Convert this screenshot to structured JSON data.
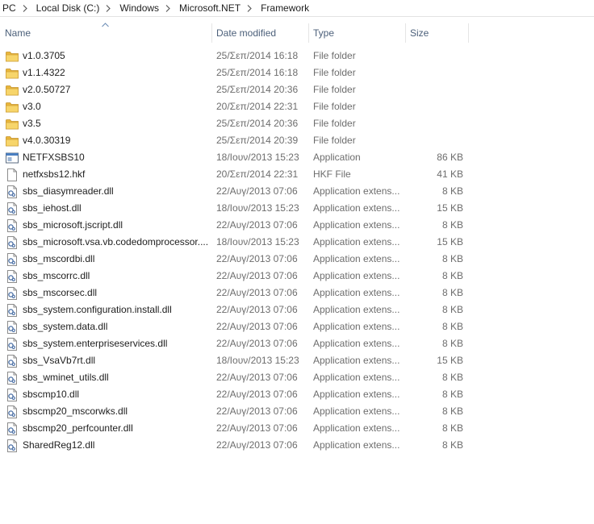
{
  "breadcrumb": {
    "items": [
      {
        "label": "PC"
      },
      {
        "label": "Local Disk (C:)"
      },
      {
        "label": "Windows"
      },
      {
        "label": "Microsoft.NET"
      },
      {
        "label": "Framework"
      }
    ]
  },
  "columns": {
    "name": "Name",
    "date": "Date modified",
    "type": "Type",
    "size": "Size"
  },
  "rows": [
    {
      "icon": "folder-icon",
      "name": "v1.0.3705",
      "date": "25/Σεπ/2014 16:18",
      "type": "File folder",
      "size": ""
    },
    {
      "icon": "folder-icon",
      "name": "v1.1.4322",
      "date": "25/Σεπ/2014 16:18",
      "type": "File folder",
      "size": ""
    },
    {
      "icon": "folder-icon",
      "name": "v2.0.50727",
      "date": "25/Σεπ/2014 20:36",
      "type": "File folder",
      "size": ""
    },
    {
      "icon": "folder-icon",
      "name": "v3.0",
      "date": "20/Σεπ/2014 22:31",
      "type": "File folder",
      "size": ""
    },
    {
      "icon": "folder-icon",
      "name": "v3.5",
      "date": "25/Σεπ/2014 20:36",
      "type": "File folder",
      "size": ""
    },
    {
      "icon": "folder-icon",
      "name": "v4.0.30319",
      "date": "25/Σεπ/2014 20:39",
      "type": "File folder",
      "size": ""
    },
    {
      "icon": "application-icon",
      "name": "NETFXSBS10",
      "date": "18/Ιουν/2013 15:23",
      "type": "Application",
      "size": "86 KB"
    },
    {
      "icon": "blank-file-icon",
      "name": "netfxsbs12.hkf",
      "date": "20/Σεπ/2014 22:31",
      "type": "HKF File",
      "size": "41 KB"
    },
    {
      "icon": "dll-file-icon",
      "name": "sbs_diasymreader.dll",
      "date": "22/Αυγ/2013 07:06",
      "type": "Application extens...",
      "size": "8 KB"
    },
    {
      "icon": "dll-file-icon",
      "name": "sbs_iehost.dll",
      "date": "18/Ιουν/2013 15:23",
      "type": "Application extens...",
      "size": "15 KB"
    },
    {
      "icon": "dll-file-icon",
      "name": "sbs_microsoft.jscript.dll",
      "date": "22/Αυγ/2013 07:06",
      "type": "Application extens...",
      "size": "8 KB"
    },
    {
      "icon": "dll-file-icon",
      "name": "sbs_microsoft.vsa.vb.codedomprocessor....",
      "date": "18/Ιουν/2013 15:23",
      "type": "Application extens...",
      "size": "15 KB"
    },
    {
      "icon": "dll-file-icon",
      "name": "sbs_mscordbi.dll",
      "date": "22/Αυγ/2013 07:06",
      "type": "Application extens...",
      "size": "8 KB"
    },
    {
      "icon": "dll-file-icon",
      "name": "sbs_mscorrc.dll",
      "date": "22/Αυγ/2013 07:06",
      "type": "Application extens...",
      "size": "8 KB"
    },
    {
      "icon": "dll-file-icon",
      "name": "sbs_mscorsec.dll",
      "date": "22/Αυγ/2013 07:06",
      "type": "Application extens...",
      "size": "8 KB"
    },
    {
      "icon": "dll-file-icon",
      "name": "sbs_system.configuration.install.dll",
      "date": "22/Αυγ/2013 07:06",
      "type": "Application extens...",
      "size": "8 KB"
    },
    {
      "icon": "dll-file-icon",
      "name": "sbs_system.data.dll",
      "date": "22/Αυγ/2013 07:06",
      "type": "Application extens...",
      "size": "8 KB"
    },
    {
      "icon": "dll-file-icon",
      "name": "sbs_system.enterpriseservices.dll",
      "date": "22/Αυγ/2013 07:06",
      "type": "Application extens...",
      "size": "8 KB"
    },
    {
      "icon": "dll-file-icon",
      "name": "sbs_VsaVb7rt.dll",
      "date": "18/Ιουν/2013 15:23",
      "type": "Application extens...",
      "size": "15 KB"
    },
    {
      "icon": "dll-file-icon",
      "name": "sbs_wminet_utils.dll",
      "date": "22/Αυγ/2013 07:06",
      "type": "Application extens...",
      "size": "8 KB"
    },
    {
      "icon": "dll-file-icon",
      "name": "sbscmp10.dll",
      "date": "22/Αυγ/2013 07:06",
      "type": "Application extens...",
      "size": "8 KB"
    },
    {
      "icon": "dll-file-icon",
      "name": "sbscmp20_mscorwks.dll",
      "date": "22/Αυγ/2013 07:06",
      "type": "Application extens...",
      "size": "8 KB"
    },
    {
      "icon": "dll-file-icon",
      "name": "sbscmp20_perfcounter.dll",
      "date": "22/Αυγ/2013 07:06",
      "type": "Application extens...",
      "size": "8 KB"
    },
    {
      "icon": "dll-file-icon",
      "name": "SharedReg12.dll",
      "date": "22/Αυγ/2013 07:06",
      "type": "Application extens...",
      "size": "8 KB"
    }
  ],
  "colors": {
    "header_text": "#4c607a",
    "secondary_text": "#6d6d6d",
    "folder_yellow": "#f2c94c"
  }
}
